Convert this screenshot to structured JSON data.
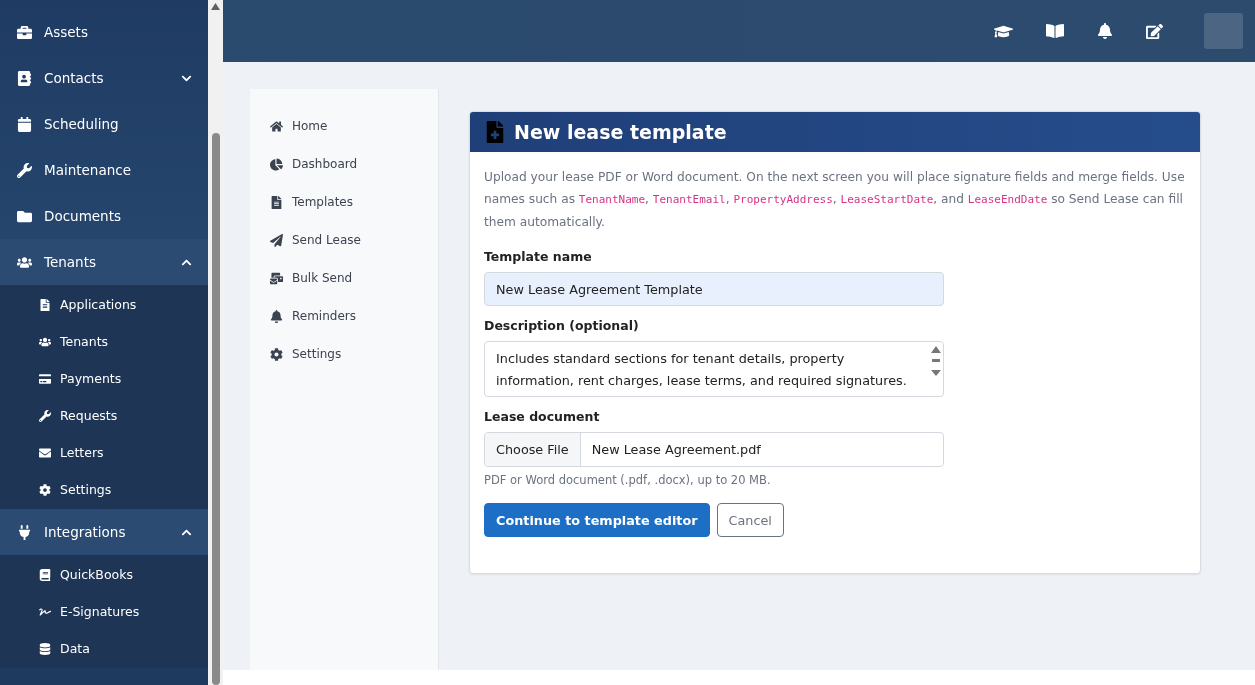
{
  "sidebar": {
    "items": [
      {
        "label": "Assets"
      },
      {
        "label": "Contacts",
        "expanded": false
      },
      {
        "label": "Scheduling"
      },
      {
        "label": "Maintenance"
      },
      {
        "label": "Documents"
      },
      {
        "label": "Tenants",
        "expanded": true,
        "children": [
          {
            "label": "Applications"
          },
          {
            "label": "Tenants"
          },
          {
            "label": "Payments"
          },
          {
            "label": "Requests"
          },
          {
            "label": "Letters"
          },
          {
            "label": "Settings"
          }
        ]
      },
      {
        "label": "Integrations",
        "expanded": true,
        "children": [
          {
            "label": "QuickBooks"
          },
          {
            "label": "E-Signatures"
          },
          {
            "label": "Data"
          }
        ]
      }
    ]
  },
  "subnav": {
    "items": [
      {
        "label": "Home"
      },
      {
        "label": "Dashboard"
      },
      {
        "label": "Templates"
      },
      {
        "label": "Send Lease"
      },
      {
        "label": "Bulk Send"
      },
      {
        "label": "Reminders"
      },
      {
        "label": "Settings"
      }
    ]
  },
  "card": {
    "title": "New lease template",
    "intro": [
      {
        "kind": "text",
        "text": "Upload your lease PDF or Word document. On the next screen you will place signature fields and merge fields. Use names such as "
      },
      {
        "kind": "code",
        "text": "TenantName"
      },
      {
        "kind": "text",
        "text": ", "
      },
      {
        "kind": "code",
        "text": "TenantEmail"
      },
      {
        "kind": "text",
        "text": ", "
      },
      {
        "kind": "code",
        "text": "PropertyAddress"
      },
      {
        "kind": "text",
        "text": ", "
      },
      {
        "kind": "code",
        "text": "LeaseStartDate"
      },
      {
        "kind": "text",
        "text": ", and "
      },
      {
        "kind": "code",
        "text": "LeaseEndDate"
      },
      {
        "kind": "text",
        "text": " so Send Lease can fill them automatically."
      }
    ],
    "name_label": "Template name",
    "name_value": "New Lease Agreement Template",
    "description_label": "Description (optional)",
    "description_value": "Includes standard sections for tenant details, property information, rent charges, lease terms, and required signatures.",
    "document_label": "Lease document",
    "file_button": "Choose File",
    "file_name": "New Lease Agreement.pdf",
    "file_hint": "PDF or Word document (.pdf, .docx), up to 20 MB.",
    "primary_button": "Continue to template editor",
    "secondary_button": "Cancel"
  }
}
